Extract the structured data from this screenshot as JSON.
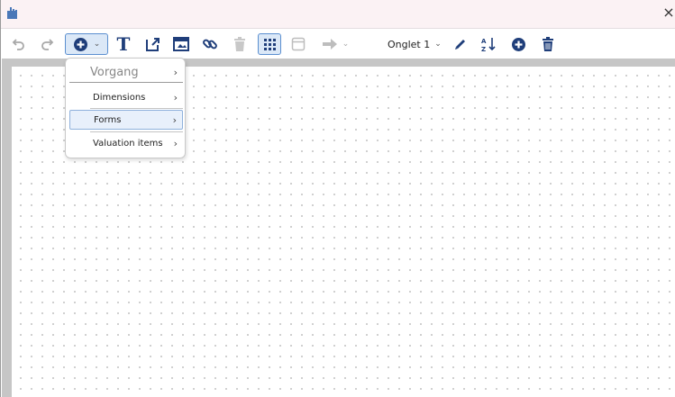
{
  "titlebar": {
    "close_glyph": "×",
    "app_icon": "app-document-icon"
  },
  "toolbar": {
    "undo_icon": "undo-icon",
    "redo_icon": "redo-icon",
    "add_icon": "plus-circle-icon",
    "text_glyph": "T",
    "tab_label": "Onglet 1",
    "accent_color": "#1f3e7a",
    "active_border_color": "#5b8fd0"
  },
  "add_menu": {
    "header": "Vorgang",
    "items": [
      {
        "label": "Dimensions"
      },
      {
        "label": "Forms"
      },
      {
        "label": "Valuation items"
      }
    ],
    "arrow_glyph": "›",
    "selected_index": 1
  }
}
